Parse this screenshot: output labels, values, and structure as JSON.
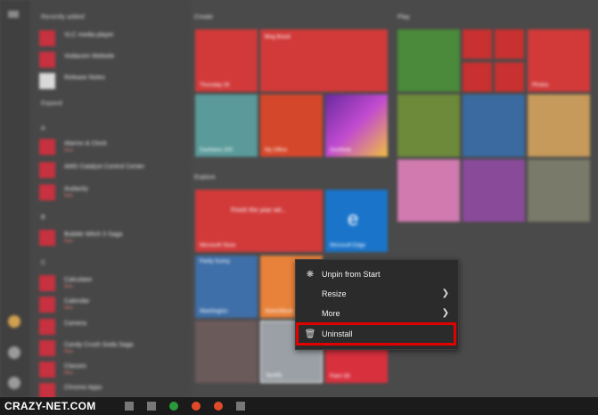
{
  "start_menu": {
    "recently_added_label": "Recently added",
    "expand_label": "Expand",
    "apps": [
      {
        "name": "VLC media player",
        "note": ""
      },
      {
        "name": "Vodacom Website",
        "note": ""
      },
      {
        "name": "Release Notes",
        "note": ""
      },
      {
        "name": "Alarms & Clock",
        "note": "New"
      },
      {
        "name": "AMD Catalyst Control Center",
        "note": ""
      },
      {
        "name": "Audacity",
        "note": "New"
      },
      {
        "name": "Bubble Witch 3 Saga",
        "note": "New"
      },
      {
        "name": "Calculator",
        "note": "New"
      },
      {
        "name": "Calendar",
        "note": "New"
      },
      {
        "name": "Camera",
        "note": ""
      },
      {
        "name": "Candy Crush Soda Saga",
        "note": "New"
      },
      {
        "name": "Classes",
        "note": "New"
      },
      {
        "name": "Chrome Apps",
        "note": ""
      }
    ],
    "letters": [
      "A",
      "B",
      "C"
    ]
  },
  "groups": {
    "create": "Create",
    "explore": "Explore",
    "play": "Play"
  },
  "tiles": {
    "thursday": "Thursday 28",
    "blog": "Blog Brasil",
    "dashlane": "Dashlane 200",
    "myoffice": "My Office",
    "onenote": "OneNote",
    "store": "Microsoft Store",
    "store_head": "Finish the year wit...",
    "edge": "Microsoft Edge",
    "weather": "Washington",
    "weather_head": "Partly Sunny",
    "sketch": "SketchBook",
    "spotify": "Spotify",
    "paint3d": "Paint 3D",
    "photos": "Photos"
  },
  "context_menu": {
    "items": [
      {
        "label": "Unpin from Start",
        "icon": "unpin-icon",
        "chevron": false
      },
      {
        "label": "Resize",
        "icon": "",
        "chevron": true
      },
      {
        "label": "More",
        "icon": "",
        "chevron": true
      },
      {
        "label": "Uninstall",
        "icon": "trash-icon",
        "chevron": false
      }
    ],
    "highlight_color": "#e00000"
  },
  "watermark": "CRAZY-NET.COM"
}
